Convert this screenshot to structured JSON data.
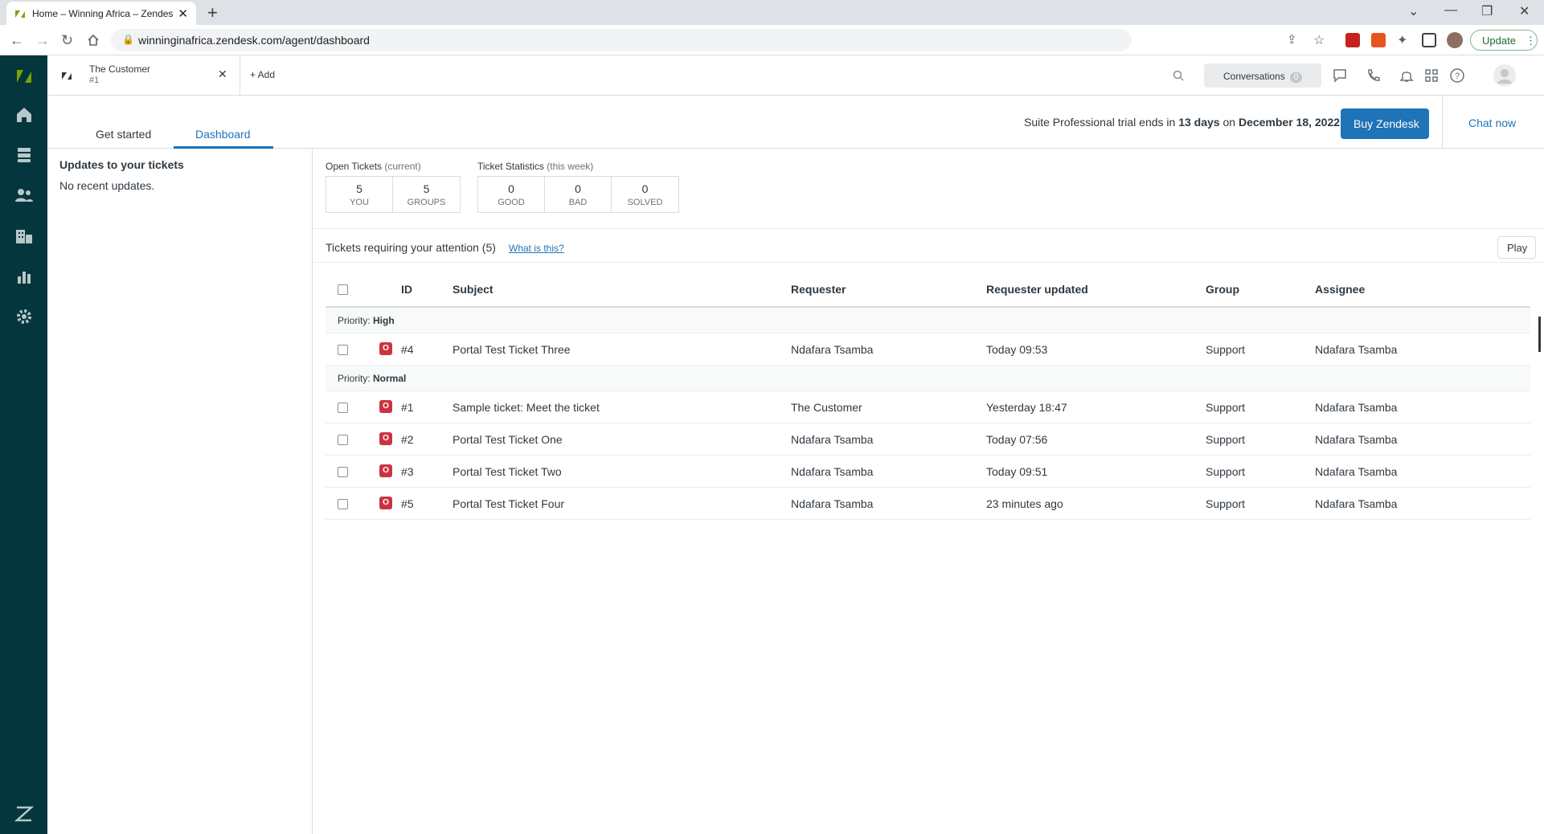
{
  "browser": {
    "tab_title": "Home – Winning Africa – Zendesk",
    "url": "winninginafrica.zendesk.com/agent/dashboard",
    "update_label": "Update"
  },
  "app_tab": {
    "title": "The Customer",
    "number": "#1",
    "add_label": "+ Add"
  },
  "toolbar": {
    "conversations_label": "Conversations",
    "conversations_count": "0"
  },
  "nav": {
    "tabs": [
      "Get started",
      "Dashboard"
    ],
    "trial_prefix": "Suite Professional trial ends in ",
    "trial_days": "13 days",
    "trial_mid": " on ",
    "trial_date": "December 18, 2022",
    "buy_label": "Buy Zendesk",
    "chat_label": "Chat now"
  },
  "updates": {
    "title": "Updates to your tickets",
    "empty": "No recent updates."
  },
  "open_tickets": {
    "title": "Open Tickets",
    "qualifier": "(current)",
    "cells": [
      {
        "value": "5",
        "label": "YOU"
      },
      {
        "value": "5",
        "label": "GROUPS"
      }
    ]
  },
  "ticket_stats": {
    "title": "Ticket Statistics",
    "qualifier": "(this week)",
    "cells": [
      {
        "value": "0",
        "label": "GOOD"
      },
      {
        "value": "0",
        "label": "BAD"
      },
      {
        "value": "0",
        "label": "SOLVED"
      }
    ]
  },
  "attention": {
    "title": "Tickets requiring your attention (5)",
    "help_link": "What is this?",
    "play_label": "Play"
  },
  "table": {
    "headers": {
      "id": "ID",
      "subject": "Subject",
      "requester": "Requester",
      "updated": "Requester updated",
      "group": "Group",
      "assignee": "Assignee"
    },
    "groups": [
      {
        "label": "Priority:",
        "value": "High",
        "rows": [
          {
            "status": "O",
            "id": "#4",
            "subject": "Portal Test Ticket Three",
            "requester": "Ndafara Tsamba",
            "updated": "Today 09:53",
            "group": "Support",
            "assignee": "Ndafara Tsamba"
          }
        ]
      },
      {
        "label": "Priority:",
        "value": "Normal",
        "rows": [
          {
            "status": "O",
            "id": "#1",
            "subject": "Sample ticket: Meet the ticket",
            "requester": "The Customer",
            "updated": "Yesterday 18:47",
            "group": "Support",
            "assignee": "Ndafara Tsamba"
          },
          {
            "status": "O",
            "id": "#2",
            "subject": "Portal Test Ticket One",
            "requester": "Ndafara Tsamba",
            "updated": "Today 07:56",
            "group": "Support",
            "assignee": "Ndafara Tsamba"
          },
          {
            "status": "O",
            "id": "#3",
            "subject": "Portal Test Ticket Two",
            "requester": "Ndafara Tsamba",
            "updated": "Today 09:51",
            "group": "Support",
            "assignee": "Ndafara Tsamba"
          },
          {
            "status": "O",
            "id": "#5",
            "subject": "Portal Test Ticket Four",
            "requester": "Ndafara Tsamba",
            "updated": "23 minutes ago",
            "group": "Support",
            "assignee": "Ndafara Tsamba"
          }
        ]
      }
    ]
  },
  "colors": {
    "sidebar": "#03363d",
    "brand_green": "#78a300",
    "accent_blue": "#1f73b7",
    "status_open": "#cc3340"
  }
}
